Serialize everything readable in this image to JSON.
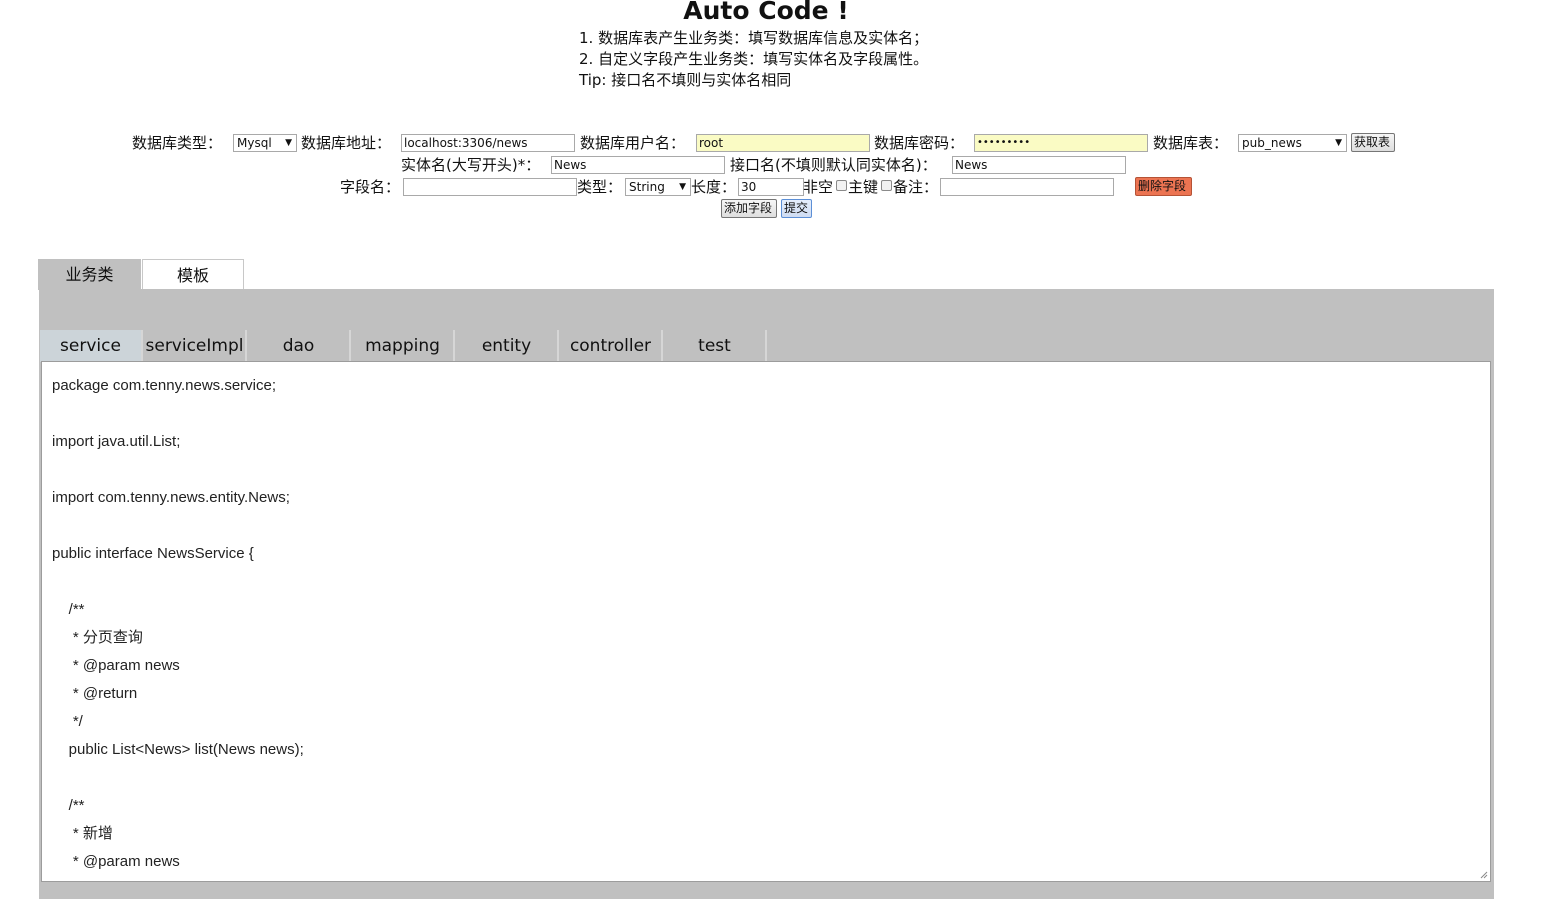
{
  "header": {
    "title": "Auto Code !",
    "tips": [
      "1. 数据库表产生业务类：填写数据库信息及实体名；",
      "2. 自定义字段产生业务类：填写实体名及字段属性。",
      "Tip: 接口名不填则与实体名相同"
    ]
  },
  "form": {
    "db_type_label": "数据库类型：",
    "db_type_value": "Mysql",
    "db_addr_label": "数据库地址：",
    "db_addr_value": "localhost:3306/news",
    "db_user_label": "数据库用户名：",
    "db_user_value": "root",
    "db_pwd_label": "数据库密码：",
    "db_pwd_value": "•••••••••",
    "db_table_label": "数据库表：",
    "db_table_value": "pub_news",
    "fetch_button": "获取表",
    "entity_label": "实体名(大写开头)*：",
    "entity_value": "News",
    "iface_label": "接口名(不填则默认同实体名)：",
    "iface_value": "News",
    "field_label": "字段名：",
    "field_value": "",
    "type_label": "类型：",
    "type_value": "String",
    "length_label": "长度：",
    "length_value": "30",
    "notnull_label": "非空",
    "pk_label": "主键",
    "remark_label": "备注：",
    "remark_value": "",
    "delete_button": "删除字段",
    "add_button": "添加字段",
    "submit_button": "提交"
  },
  "outer_tabs": [
    "业务类",
    "模板"
  ],
  "inner_tabs": [
    "service",
    "serviceImpl",
    "dao",
    "mapping",
    "entity",
    "controller",
    "test"
  ],
  "code_text": "package com.tenny.news.service;\n\nimport java.util.List;\n\nimport com.tenny.news.entity.News;\n\npublic interface NewsService {\n\n\t/**\n\t * 分页查询\n\t * @param news\n\t * @return\n\t */\n\tpublic List<News> list(News news);\n\n\t/**\n\t * 新增\n\t * @param news"
}
